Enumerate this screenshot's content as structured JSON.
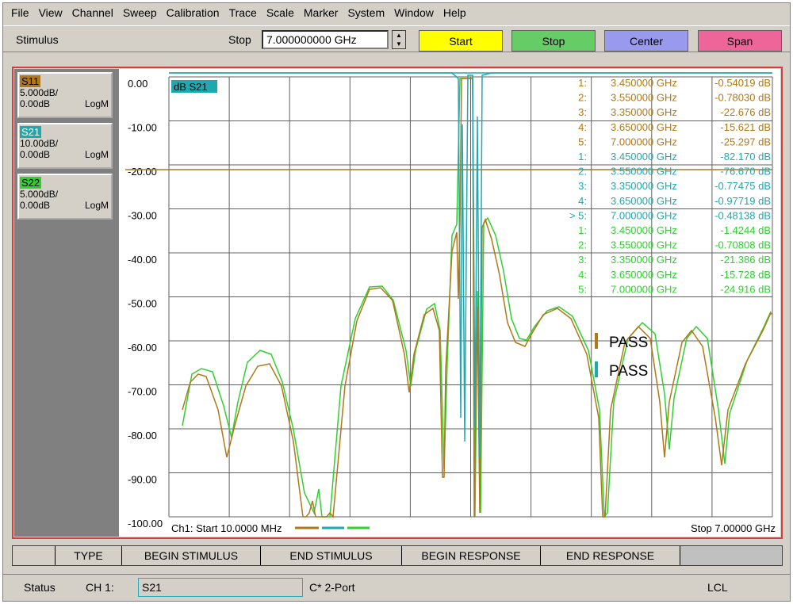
{
  "menu": [
    "File",
    "View",
    "Channel",
    "Sweep",
    "Calibration",
    "Trace",
    "Scale",
    "Marker",
    "System",
    "Window",
    "Help"
  ],
  "toolbar": {
    "stimulus_label": "Stimulus",
    "stop_label": "Stop",
    "stop_value": "7.000000000 GHz",
    "buttons": [
      {
        "label": "Start",
        "color": "#ffff00"
      },
      {
        "label": "Stop",
        "color": "#66cc66"
      },
      {
        "label": "Center",
        "color": "#9999ee"
      },
      {
        "label": "Span",
        "color": "#ee6699"
      }
    ]
  },
  "traces": [
    {
      "name": "S11",
      "scale": "5.000dB/",
      "ref": "0.00dB",
      "format": "LogM",
      "color": "#b07818"
    },
    {
      "name": "S21",
      "scale": "10.00dB/",
      "ref": "0.00dB",
      "format": "LogM",
      "color": "#20a8b0"
    },
    {
      "name": "S22",
      "scale": "5.000dB/",
      "ref": "0.00dB",
      "format": "LogM",
      "color": "#30d030"
    }
  ],
  "plot": {
    "active_trace_label": "dB S21",
    "y_ticks": [
      "0.00",
      "-10.00",
      "-20.00",
      "-30.00",
      "-40.00",
      "-50.00",
      "-60.00",
      "-70.00",
      "-80.00",
      "-90.00",
      "-100.00"
    ],
    "start_label": "Ch1: Start  10.0000 MHz",
    "stop_label": "Stop  7.00000 GHz",
    "pass_labels": [
      "PASS",
      "PASS"
    ],
    "markers": [
      {
        "num": "1:",
        "freq": "3.450000 GHz",
        "val": "-0.54019 dB",
        "trace": "S11"
      },
      {
        "num": "2:",
        "freq": "3.550000 GHz",
        "val": "-0.78030 dB",
        "trace": "S11"
      },
      {
        "num": "3:",
        "freq": "3.350000 GHz",
        "val": "-22.676 dB",
        "trace": "S11"
      },
      {
        "num": "4:",
        "freq": "3.650000 GHz",
        "val": "-15.621 dB",
        "trace": "S11"
      },
      {
        "num": "5:",
        "freq": "7.000000 GHz",
        "val": "-25.297 dB",
        "trace": "S11"
      },
      {
        "num": "1:",
        "freq": "3.450000 GHz",
        "val": "-82.170 dB",
        "trace": "S21"
      },
      {
        "num": "2:",
        "freq": "3.550000 GHz",
        "val": "-76.670 dB",
        "trace": "S21"
      },
      {
        "num": "3:",
        "freq": "3.350000 GHz",
        "val": "-0.77475 dB",
        "trace": "S21"
      },
      {
        "num": "4:",
        "freq": "3.650000 GHz",
        "val": "-0.97719 dB",
        "trace": "S21"
      },
      {
        "num": "> 5:",
        "freq": "7.000000 GHz",
        "val": "-0.48138 dB",
        "trace": "S21"
      },
      {
        "num": "1:",
        "freq": "3.450000 GHz",
        "val": "-1.4244 dB",
        "trace": "S22"
      },
      {
        "num": "2:",
        "freq": "3.550000 GHz",
        "val": "-0.70808 dB",
        "trace": "S22"
      },
      {
        "num": "3:",
        "freq": "3.350000 GHz",
        "val": "-21.386 dB",
        "trace": "S22"
      },
      {
        "num": "4:",
        "freq": "3.650000 GHz",
        "val": "-15.728 dB",
        "trace": "S22"
      },
      {
        "num": "5:",
        "freq": "7.000000 GHz",
        "val": "-24.916 dB",
        "trace": "S22"
      }
    ]
  },
  "softkeys": [
    "",
    "TYPE",
    "BEGIN STIMULUS",
    "END STIMULUS",
    "BEGIN RESPONSE",
    "END RESPONSE",
    ""
  ],
  "status": {
    "label": "Status",
    "channel": "CH 1:",
    "field": "S21",
    "cal": "C* 2-Port",
    "mode": "LCL"
  }
}
